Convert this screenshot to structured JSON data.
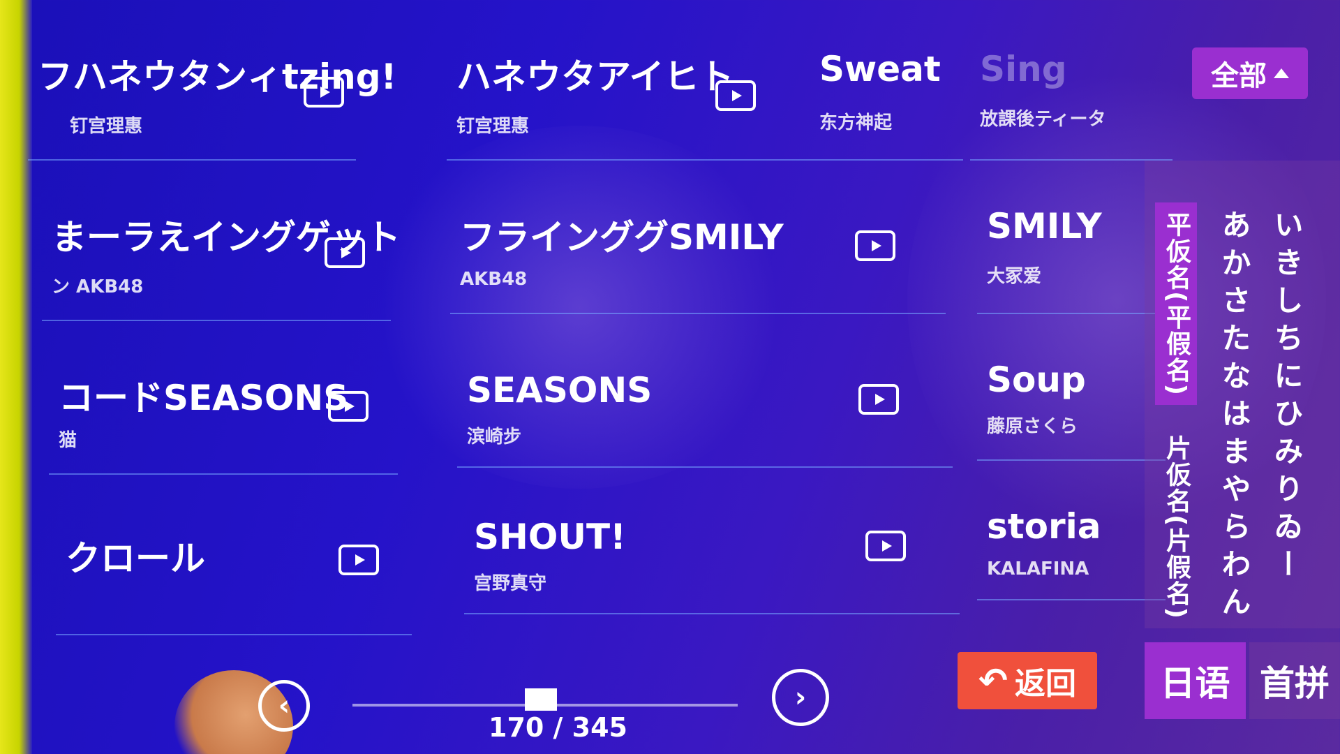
{
  "filter_button": {
    "label": "全部"
  },
  "songs": [
    {
      "title": "フハネウタンィtzing!",
      "artist": "钉宫理惠"
    },
    {
      "title": "ハネウタアイヒト",
      "artist": "钉宫理惠"
    },
    {
      "title": "Sweat",
      "artist": "东方神起"
    },
    {
      "title": "Sing",
      "artist": "放課後ティータ"
    },
    {
      "title": "まーラえイングゲット",
      "artist": "ン  AKB48"
    },
    {
      "title": "フラインググSMILY",
      "artist": "AKB48"
    },
    {
      "title": "SMILY",
      "artist": "大冢爱"
    },
    {
      "title": "コードSEASONS",
      "artist": "猫"
    },
    {
      "title": "SEASONS",
      "artist": "滨崎步"
    },
    {
      "title": "Soup",
      "artist": "藤原さくら"
    },
    {
      "title": "クロール",
      "artist": ""
    },
    {
      "title": "SHOUT!",
      "artist": "宫野真守"
    },
    {
      "title": "storia",
      "artist": "KALAFINA"
    }
  ],
  "side_panel": {
    "tab_hiragana": "平仮名(平假名)",
    "tab_katakana": "片仮名(片假名)",
    "kana_col_1": "あかさたなはまやらわん",
    "kana_col_2": "いきしちにひみりゐー"
  },
  "pagination": {
    "text": "170 / 345",
    "current": 170,
    "total": 345,
    "position": 0.49
  },
  "back_button": {
    "label": "返回"
  },
  "language_tabs": [
    {
      "label": "日语",
      "active": true
    },
    {
      "label": "首拼",
      "active": false
    }
  ],
  "colors": {
    "accent_purple": "#9a2fd0",
    "back_red": "#f0503c",
    "background_blue": "#2513c9"
  }
}
